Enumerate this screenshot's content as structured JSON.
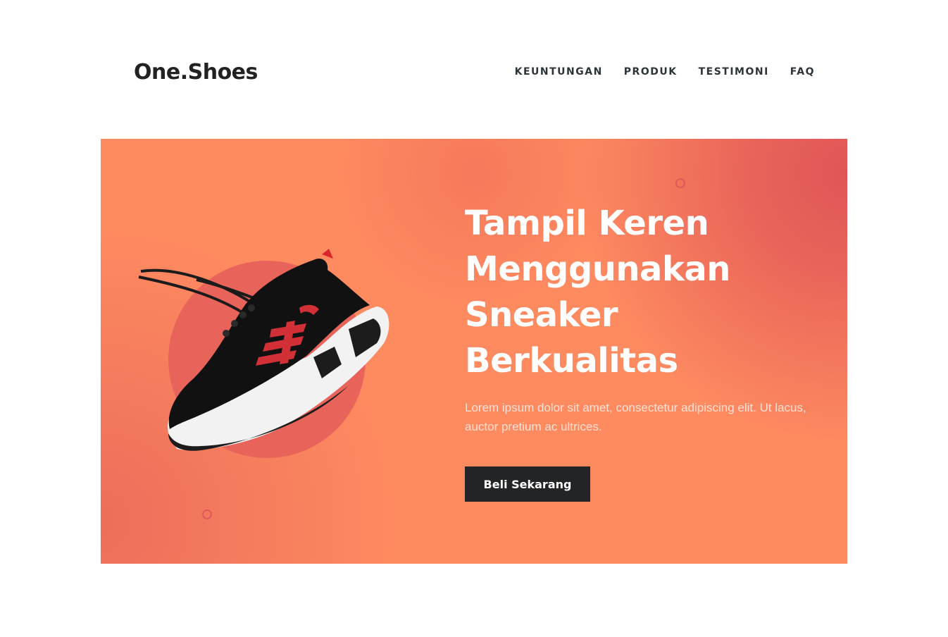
{
  "header": {
    "logo": "One.Shoes",
    "nav": [
      "KEUNTUNGAN",
      "PRODUK",
      "TESTIMONI",
      "FAQ"
    ]
  },
  "hero": {
    "headline": "Tampil Keren Menggunakan Sneaker Berkualitas",
    "description": "Lorem ipsum dolor sit amet, consectetur adipiscing elit. Ut lacus, auctor pretium ac ultrices.",
    "cta_label": "Beli Sekarang",
    "shoe_image": "sneaker-image"
  },
  "colors": {
    "hero_bg": "#fe8a60",
    "accent": "#e0595a",
    "button_bg": "#222426",
    "text_dark": "#2c3438"
  }
}
